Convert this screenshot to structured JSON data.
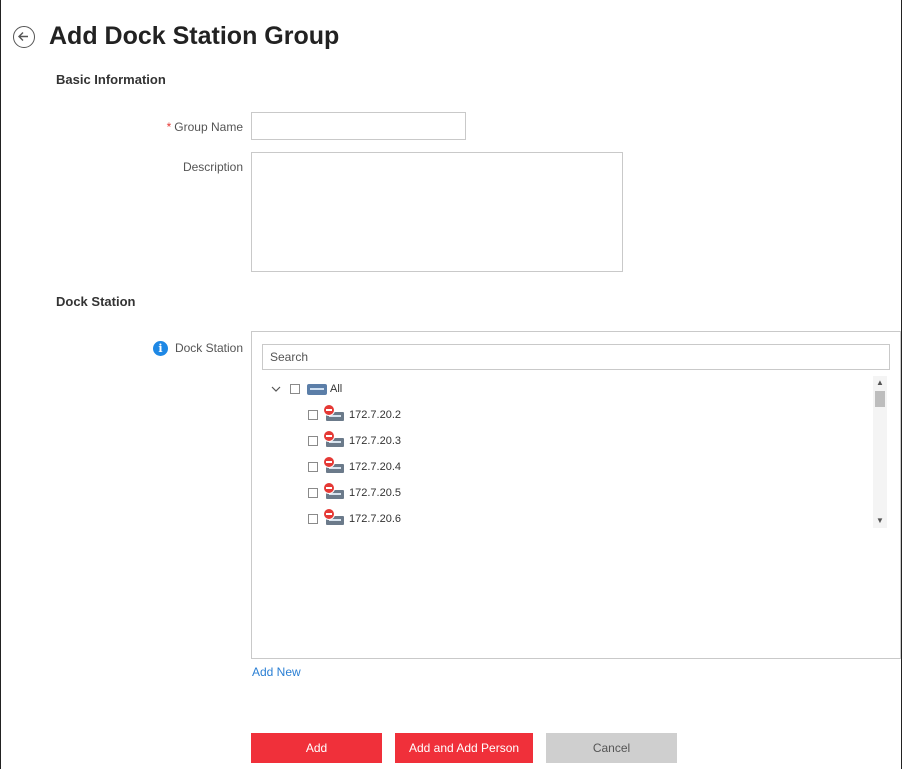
{
  "header": {
    "title": "Add Dock Station Group"
  },
  "basic_information": {
    "section_title": "Basic Information",
    "group_name_label": "Group Name",
    "group_name_required_mark": "*",
    "group_name_value": "",
    "description_label": "Description",
    "description_value": ""
  },
  "dock_station": {
    "section_title": "Dock Station",
    "field_label": "Dock Station",
    "search_placeholder": "Search",
    "tree": {
      "root_label": "All",
      "items": [
        {
          "label": "172.7.20.2",
          "status": "offline",
          "checked": false
        },
        {
          "label": "172.7.20.3",
          "status": "offline",
          "checked": false
        },
        {
          "label": "172.7.20.4",
          "status": "offline",
          "checked": false
        },
        {
          "label": "172.7.20.5",
          "status": "offline",
          "checked": false
        },
        {
          "label": "172.7.20.6",
          "status": "offline",
          "checked": false
        }
      ]
    },
    "add_new_label": "Add New"
  },
  "footer": {
    "add_label": "Add",
    "add_and_add_person_label": "Add and Add Person",
    "cancel_label": "Cancel"
  },
  "colors": {
    "primary_red": "#f0303a",
    "link_blue": "#2a7fd4",
    "info_blue": "#1e88e5",
    "offline_red": "#e53935"
  }
}
